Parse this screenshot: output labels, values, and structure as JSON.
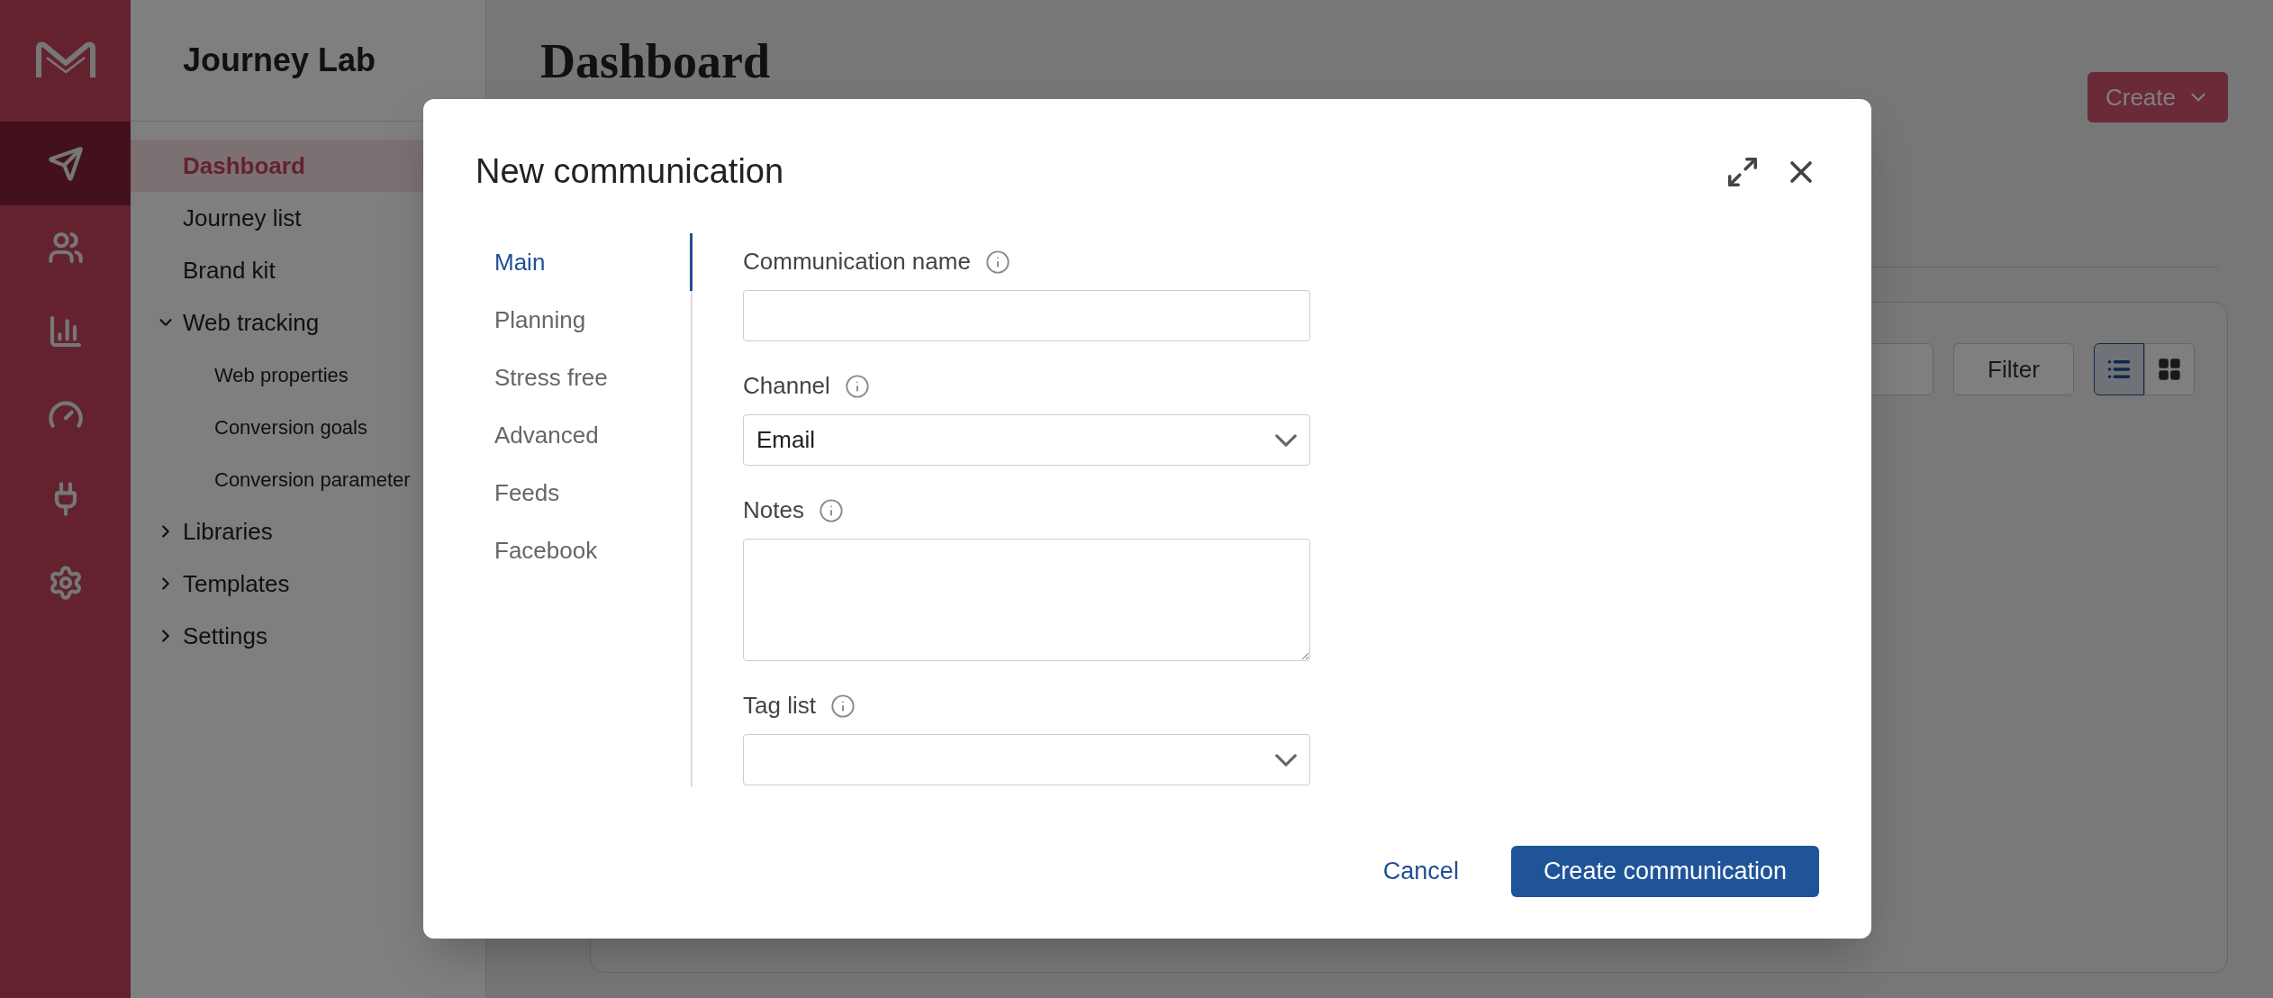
{
  "app": {
    "title": "Journey Lab"
  },
  "rail": [
    {
      "kind": "send",
      "selected": true
    },
    {
      "kind": "people",
      "selected": false
    },
    {
      "kind": "chart",
      "selected": false
    },
    {
      "kind": "gauge",
      "selected": false
    },
    {
      "kind": "plug",
      "selected": false
    },
    {
      "kind": "settings",
      "selected": false
    }
  ],
  "sidebar": {
    "items": [
      {
        "label": "Dashboard",
        "selected": true
      },
      {
        "label": "Journey list",
        "selected": false
      },
      {
        "label": "Brand kit",
        "selected": false
      },
      {
        "label": "Web tracking",
        "selected": false,
        "expanded": true,
        "children": [
          {
            "label": "Web properties",
            "selected": false
          },
          {
            "label": "Conversion goals",
            "selected": false
          },
          {
            "label": "Conversion parameter",
            "selected": false
          }
        ]
      },
      {
        "label": "Libraries",
        "selected": false,
        "expanded": false
      },
      {
        "label": "Templates",
        "selected": false,
        "expanded": false
      },
      {
        "label": "Settings",
        "selected": false,
        "expanded": false
      }
    ]
  },
  "page": {
    "title": "Dashboard",
    "create_button": "Create",
    "filter_button": "Filter",
    "view_toggle": [
      {
        "kind": "list",
        "selected": true
      },
      {
        "kind": "grid",
        "selected": false
      }
    ]
  },
  "dialog": {
    "title": "New communication",
    "tabs": [
      {
        "label": "Main",
        "selected": true
      },
      {
        "label": "Planning",
        "selected": false
      },
      {
        "label": "Stress free",
        "selected": false
      },
      {
        "label": "Advanced",
        "selected": false
      },
      {
        "label": "Feeds",
        "selected": false
      },
      {
        "label": "Facebook",
        "selected": false
      }
    ],
    "fields": [
      {
        "label": "Communication name",
        "kind": "text"
      },
      {
        "label": "Channel",
        "kind": "select",
        "value": "Email"
      },
      {
        "label": "Notes",
        "kind": "textarea"
      },
      {
        "label": "Tag list",
        "kind": "select"
      }
    ],
    "cancel_button": "Cancel",
    "submit_button": "Create communication"
  }
}
